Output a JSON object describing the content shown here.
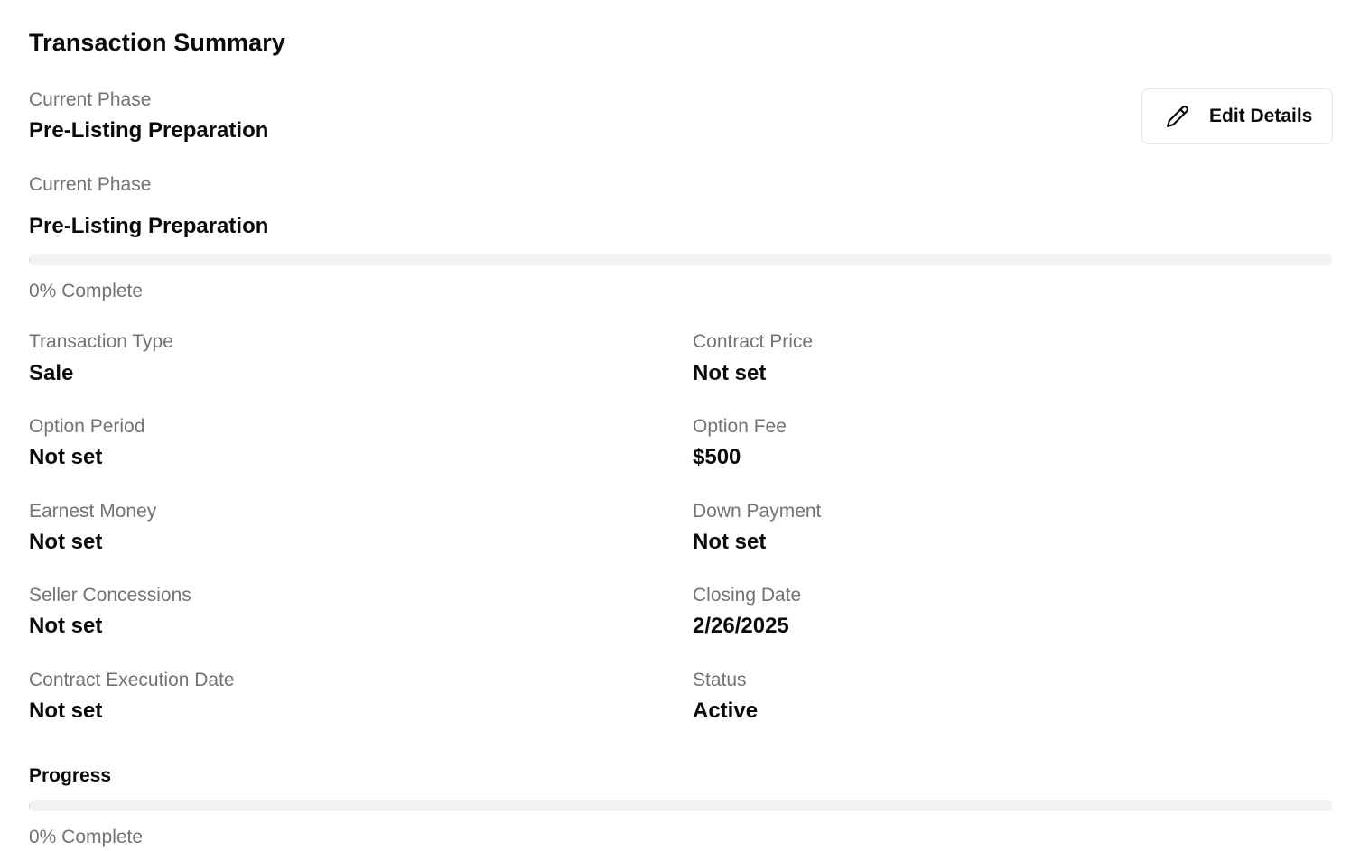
{
  "header": {
    "title": "Transaction Summary",
    "edit_button_label": "Edit Details",
    "edit_icon": "pencil-icon"
  },
  "phase_top": {
    "label": "Current Phase",
    "value": "Pre-Listing Preparation"
  },
  "phase_card": {
    "label": "Current Phase",
    "value": "Pre-Listing Preparation",
    "progress_percent": 0,
    "progress_text": "0% Complete"
  },
  "details": {
    "transaction_type": {
      "label": "Transaction Type",
      "value": "Sale"
    },
    "contract_price": {
      "label": "Contract Price",
      "value": "Not set"
    },
    "option_period": {
      "label": "Option Period",
      "value": "Not set"
    },
    "option_fee": {
      "label": "Option Fee",
      "value": "$500"
    },
    "earnest_money": {
      "label": "Earnest Money",
      "value": "Not set"
    },
    "down_payment": {
      "label": "Down Payment",
      "value": "Not set"
    },
    "seller_concessions": {
      "label": "Seller Concessions",
      "value": "Not set"
    },
    "closing_date": {
      "label": "Closing Date",
      "value": "2/26/2025"
    },
    "contract_execution_date": {
      "label": "Contract Execution Date",
      "value": "Not set"
    },
    "status": {
      "label": "Status",
      "value": "Active"
    }
  },
  "progress_section": {
    "heading": "Progress",
    "progress_percent": 0,
    "progress_text": "0% Complete"
  }
}
